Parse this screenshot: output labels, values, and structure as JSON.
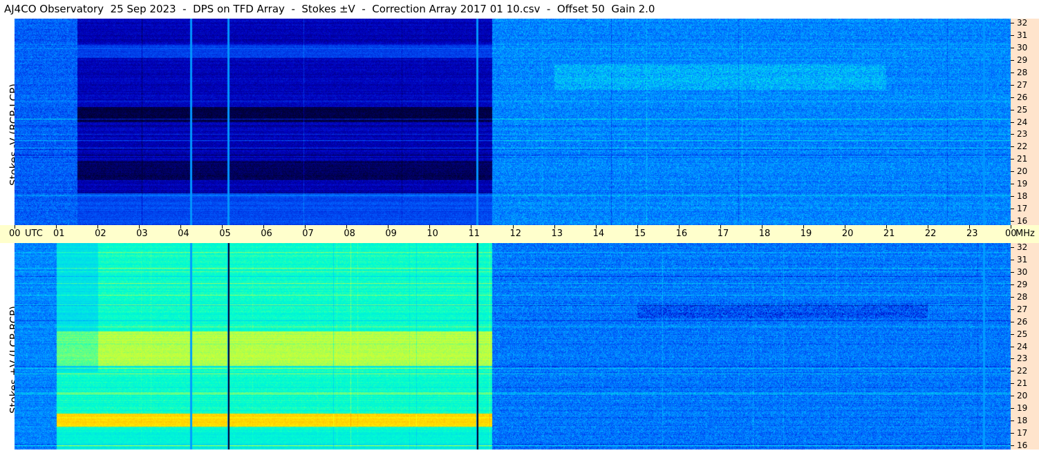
{
  "title": "AJ4CO Observatory  25 Sep 2023  -  DPS on TFD Array  -  Stokes ±V  -  Correction Array 2017 01 10.csv  -  Offset 50  Gain 2.0",
  "chart_data": [
    {
      "type": "heatmap",
      "panel": "top",
      "ylabel": "Stokes -V (RCP-LCP)",
      "x_unit": "UTC",
      "x_range_hours": [
        0,
        24
      ],
      "y_unit": "MHz",
      "y_range": [
        16,
        32
      ],
      "colormap": [
        "#000030",
        "#0000c0",
        "#0060ff",
        "#00c0ff",
        "#00ffd0",
        "#c0ff40",
        "#ffff00",
        "#ffa000",
        "#ff4080"
      ],
      "notable_features": {
        "dark_period_hours": [
          1.5,
          11.5
        ],
        "vertical_lines_hours": [
          4.25,
          5.15,
          11.15,
          23.35
        ]
      }
    },
    {
      "type": "heatmap",
      "panel": "bottom",
      "ylabel": "Stokes +V (LCP-RCP)",
      "x_unit": "UTC",
      "x_range_hours": [
        0,
        24
      ],
      "y_unit": "MHz",
      "y_range": [
        16,
        32
      ],
      "colormap": [
        "#000030",
        "#0000c0",
        "#0060ff",
        "#00c0ff",
        "#00ffd0",
        "#c0ff40",
        "#ffff00",
        "#ffa000",
        "#ff4080"
      ],
      "notable_features": {
        "bright_period_hours": [
          1.0,
          11.5
        ],
        "vertical_lines_hours": [
          4.25,
          5.15,
          11.15,
          23.35
        ]
      }
    }
  ],
  "time_axis": {
    "labels": [
      "00",
      "UTC",
      "01",
      "02",
      "03",
      "04",
      "05",
      "06",
      "07",
      "08",
      "09",
      "10",
      "11",
      "12",
      "13",
      "14",
      "15",
      "16",
      "17",
      "18",
      "19",
      "20",
      "21",
      "22",
      "23",
      "00",
      "MHz"
    ],
    "hours": [
      0,
      1,
      2,
      3,
      4,
      5,
      6,
      7,
      8,
      9,
      10,
      11,
      12,
      13,
      14,
      15,
      16,
      17,
      18,
      19,
      20,
      21,
      22,
      23,
      24
    ]
  },
  "freq_axis": {
    "labels": [
      "32",
      "31",
      "30",
      "29",
      "28",
      "27",
      "26",
      "25",
      "24",
      "23",
      "22",
      "21",
      "20",
      "19",
      "18",
      "17",
      "16"
    ],
    "values": [
      32,
      31,
      30,
      29,
      28,
      27,
      26,
      25,
      24,
      23,
      22,
      21,
      20,
      19,
      18,
      17,
      16
    ]
  }
}
